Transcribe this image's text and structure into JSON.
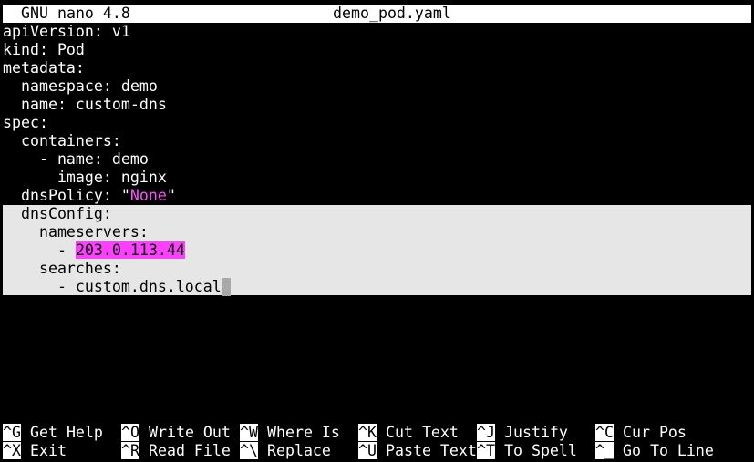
{
  "title_bar": {
    "app": "GNU nano 4.8",
    "filename": "demo_pod.yaml"
  },
  "editor": {
    "lines": [
      "apiVersion: v1",
      "kind: Pod",
      "metadata:",
      "  namespace: demo",
      "  name: custom-dns",
      "spec:",
      "  containers:",
      "    - name: demo",
      "      image: nginx",
      "  dnsPolicy: \"",
      "None",
      "\"",
      "  dnsConfig:",
      "    nameservers:",
      "      - ",
      "203.0.113.44",
      "    searches:",
      "      - custom.dns.local"
    ]
  },
  "shortcuts": [
    {
      "key": "^G",
      "label": "Get Help"
    },
    {
      "key": "^O",
      "label": "Write Out"
    },
    {
      "key": "^W",
      "label": "Where Is"
    },
    {
      "key": "^K",
      "label": "Cut Text"
    },
    {
      "key": "^J",
      "label": "Justify"
    },
    {
      "key": "^C",
      "label": "Cur Pos"
    },
    {
      "key": "^X",
      "label": "Exit"
    },
    {
      "key": "^R",
      "label": "Read File"
    },
    {
      "key": "^\\",
      "label": "Replace"
    },
    {
      "key": "^U",
      "label": "Paste Text"
    },
    {
      "key": "^T",
      "label": "To Spell"
    },
    {
      "key": "^_",
      "label": "Go To Line"
    }
  ],
  "colors": {
    "background": "#000000",
    "text": "#ffffff",
    "title_bg": "#ffffff",
    "selection_bg": "#e6e6e6",
    "string_highlight": "#ff4dff",
    "cursor": "#a9a9a9"
  }
}
